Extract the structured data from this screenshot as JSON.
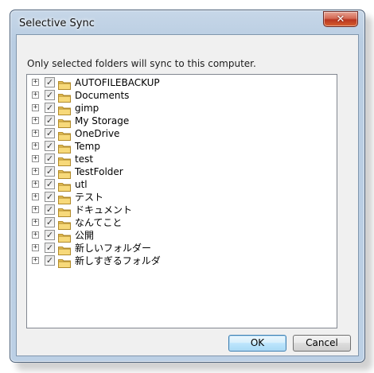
{
  "window": {
    "title": "Selective Sync",
    "close_glyph": "✕"
  },
  "instruction": "Only selected folders will sync to this computer.",
  "folders": [
    {
      "label": "AUTOFILEBACKUP",
      "checked": true,
      "icon": "folder-icon"
    },
    {
      "label": "Documents",
      "checked": true,
      "icon": "folder-icon"
    },
    {
      "label": "gimp",
      "checked": true,
      "icon": "folder-icon"
    },
    {
      "label": "My Storage",
      "checked": true,
      "icon": "folder-icon"
    },
    {
      "label": "OneDrive",
      "checked": true,
      "icon": "folder-icon"
    },
    {
      "label": "Temp",
      "checked": true,
      "icon": "folder-icon"
    },
    {
      "label": "test",
      "checked": true,
      "icon": "folder-icon"
    },
    {
      "label": "TestFolder",
      "checked": true,
      "icon": "folder-icon"
    },
    {
      "label": "utl",
      "checked": true,
      "icon": "folder-icon"
    },
    {
      "label": "テスト",
      "checked": true,
      "icon": "folder-icon"
    },
    {
      "label": "ドキュメント",
      "checked": true,
      "icon": "folder-icon"
    },
    {
      "label": "なんてこと",
      "checked": true,
      "icon": "folder-icon"
    },
    {
      "label": "公開",
      "checked": true,
      "icon": "folder-icon"
    },
    {
      "label": "新しいフォルダー",
      "checked": true,
      "icon": "folder-icon"
    },
    {
      "label": "新しすぎるフォルダ",
      "checked": true,
      "icon": "folder-icon"
    }
  ],
  "buttons": {
    "ok": "OK",
    "cancel": "Cancel"
  },
  "glyphs": {
    "expander": "+",
    "check": "✓"
  }
}
